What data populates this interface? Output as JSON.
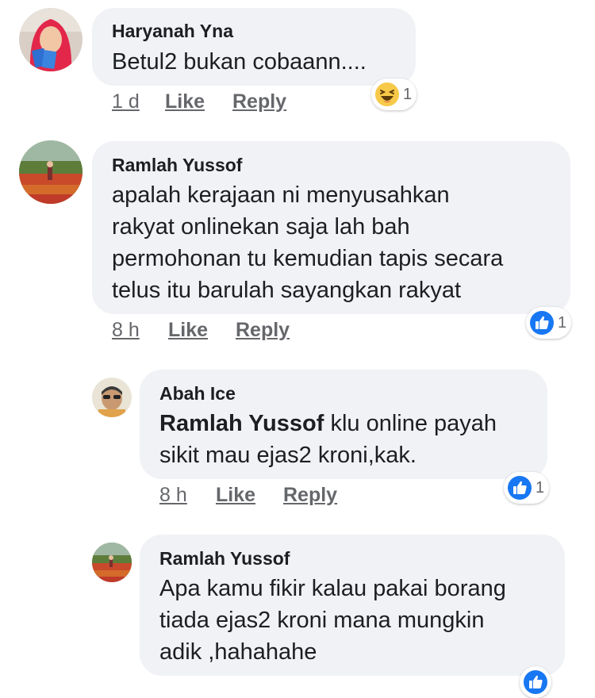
{
  "comments": [
    {
      "author": "Haryanah Yna",
      "text_lines": [
        "Betul2 bukan cobaann...."
      ],
      "time": "1 d",
      "like_label": "Like",
      "reply_label": "Reply",
      "reaction": {
        "icon": "haha-emoji-icon",
        "count": "1"
      }
    },
    {
      "author": "Ramlah Yussof",
      "text_lines": [
        "apalah kerajaan ni menyusahkan",
        "rakyat onlinekan saja lah bah",
        "permohonan tu kemudian tapis secara",
        "telus itu barulah sayangkan rakyat"
      ],
      "time": "8 h",
      "like_label": "Like",
      "reply_label": "Reply",
      "reaction": {
        "icon": "like-thumb-icon",
        "count": "1"
      }
    },
    {
      "author": "Abah Ice",
      "mention": "Ramlah Yussof",
      "text_first_rest": " klu online payah",
      "text_lines": [
        "sikit mau ejas2 kroni,kak."
      ],
      "time": "8 h",
      "like_label": "Like",
      "reply_label": "Reply",
      "reaction": {
        "icon": "like-thumb-icon",
        "count": "1"
      }
    },
    {
      "author": "Ramlah Yussof",
      "text_lines": [
        "Apa kamu fikir kalau pakai borang",
        "tiada ejas2 kroni mana mungkin",
        "adik ,hahahahe"
      ],
      "reaction": {
        "icon": "like-thumb-icon"
      }
    }
  ],
  "colors": {
    "bubble": "#f0f2f5",
    "meta": "#65676b",
    "like_blue": "#1877f2",
    "haha_yellow": "#f7c948"
  }
}
